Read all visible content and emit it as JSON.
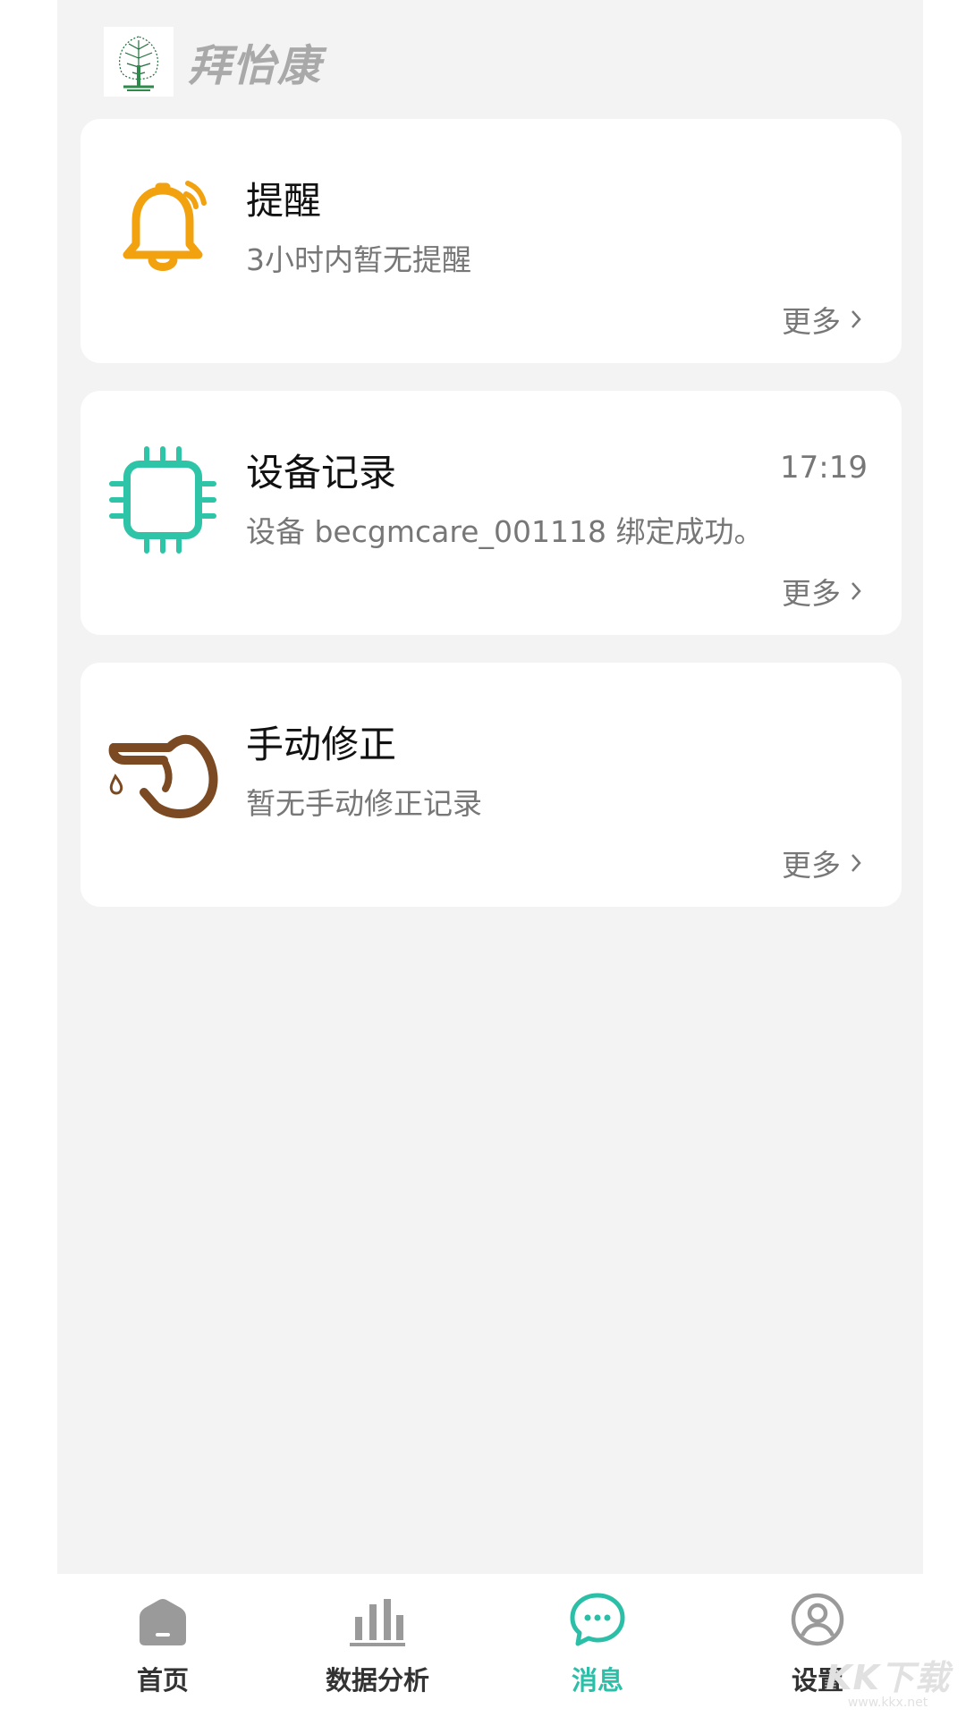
{
  "app": {
    "brand_name": "拜怡康"
  },
  "cards": [
    {
      "title": "提醒",
      "subtitle": "3小时内暂无提醒",
      "more": "更多",
      "icon": "bell-icon",
      "color": "#f2a10f"
    },
    {
      "title": "设备记录",
      "subtitle": "设备 becgmcare_001118 绑定成功。",
      "time": "17:19",
      "more": "更多",
      "icon": "chip-icon",
      "color": "#2ec4a8"
    },
    {
      "title": "手动修正",
      "subtitle": "暂无手动修正记录",
      "more": "更多",
      "icon": "finger-drop-icon",
      "color": "#7b4a22"
    }
  ],
  "tabs": [
    {
      "label": "首页",
      "icon": "home-icon",
      "active": false
    },
    {
      "label": "数据分析",
      "icon": "bar-chart-icon",
      "active": false
    },
    {
      "label": "消息",
      "icon": "message-icon",
      "active": true
    },
    {
      "label": "设置",
      "icon": "user-icon",
      "active": false
    }
  ],
  "watermark": {
    "main": "KK下载",
    "sub": "www.kkx.net"
  },
  "colors": {
    "accent": "#2bbfa8",
    "background": "#f3f3f3",
    "inactive_tab": "#9a9a9a"
  }
}
